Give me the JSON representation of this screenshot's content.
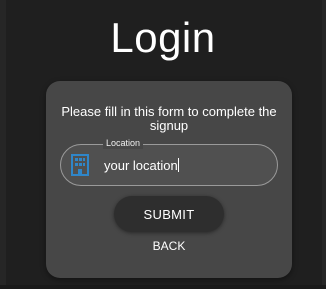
{
  "page": {
    "title": "Login"
  },
  "form": {
    "intro": "Please fill in this form to complete the signup",
    "location_field": {
      "label": "Location",
      "value": "your location",
      "icon": "building-icon"
    },
    "submit_label": "SUBMIT",
    "back_label": "BACK"
  },
  "colors": {
    "background": "#1f1f1f",
    "card": "#474747",
    "icon_accent": "#2f86c9",
    "button": "#2e2e2e"
  }
}
